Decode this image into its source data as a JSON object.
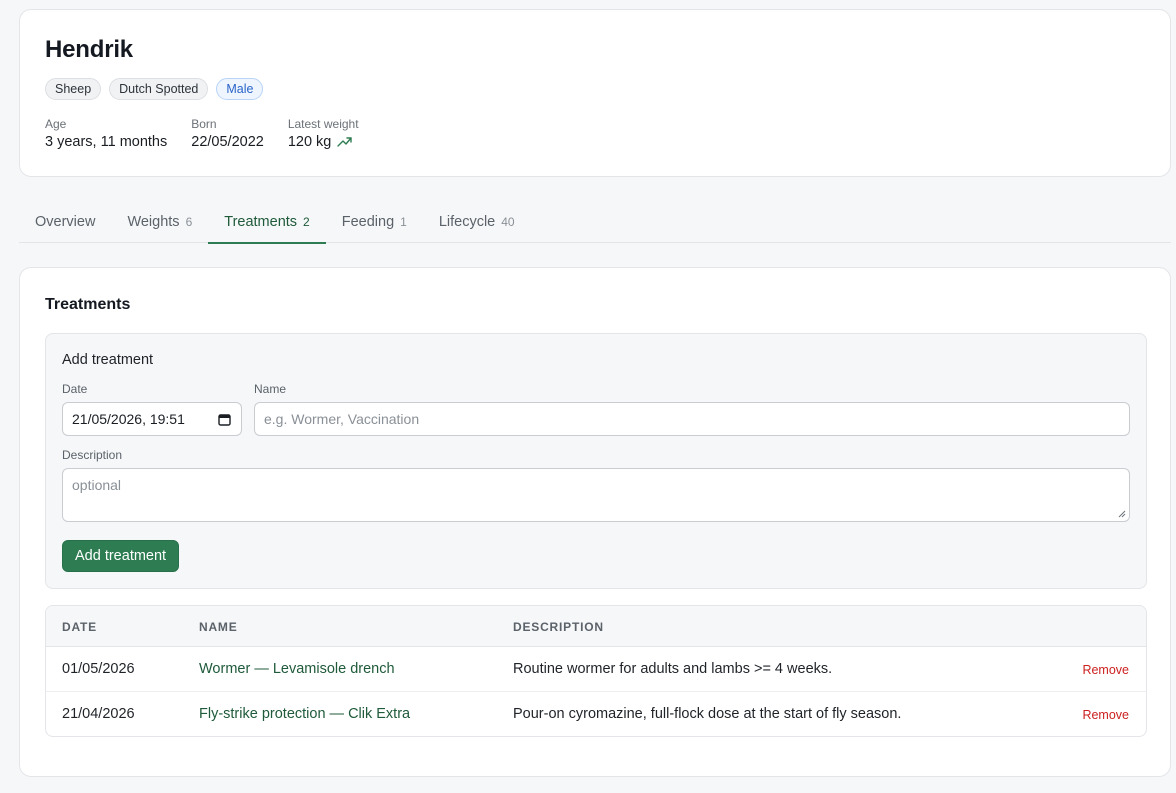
{
  "animal": {
    "name": "Hendrik",
    "tags": {
      "species": "Sheep",
      "breed": "Dutch Spotted",
      "sex": "Male"
    },
    "stats": {
      "age_label": "Age",
      "age_value": "3 years, 11 months",
      "born_label": "Born",
      "born_value": "22/05/2022",
      "weight_label": "Latest weight",
      "weight_value": "120 kg",
      "weight_trend_icon": "trending-up-icon"
    }
  },
  "tabs": [
    {
      "label": "Overview",
      "count": ""
    },
    {
      "label": "Weights",
      "count": "6"
    },
    {
      "label": "Treatments",
      "count": "2",
      "active": true
    },
    {
      "label": "Feeding",
      "count": "1"
    },
    {
      "label": "Lifecycle",
      "count": "40"
    }
  ],
  "treatments": {
    "title": "Treatments",
    "form": {
      "title": "Add treatment",
      "date_label": "Date",
      "date_value": "21/05/2026, 19:51",
      "name_label": "Name",
      "name_placeholder": "e.g. Wormer, Vaccination",
      "description_label": "Description",
      "description_placeholder": "optional",
      "submit_label": "Add treatment"
    },
    "table": {
      "headers": {
        "date": "DATE",
        "name": "NAME",
        "description": "DESCRIPTION"
      },
      "rows": [
        {
          "date": "01/05/2026",
          "name": "Wormer — Levamisole drench",
          "description": "Routine wormer for adults and lambs >= 4 weeks.",
          "action": "Remove"
        },
        {
          "date": "21/04/2026",
          "name": "Fly-strike protection — Clik Extra",
          "description": "Pour-on cyromazine, full-flock dose at the start of fly season.",
          "action": "Remove"
        }
      ]
    }
  },
  "colors": {
    "accent": "#2e7d52",
    "danger": "#cc1f1f",
    "sex_badge": "#2a64c8"
  }
}
